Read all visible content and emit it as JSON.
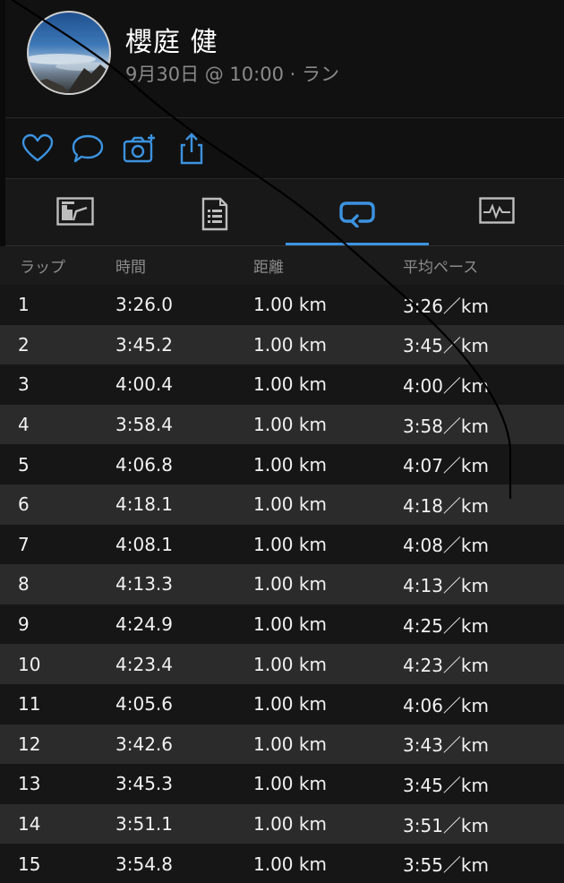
{
  "header": {
    "name": "櫻庭 健",
    "subtitle": "9月30日 @ 10:00 · ラン"
  },
  "actions": {
    "icons": [
      "heart-icon",
      "comment-icon",
      "add-photo-icon",
      "share-icon"
    ]
  },
  "tabs": {
    "items": [
      "summary-chart-icon",
      "details-document-icon",
      "laps-loop-icon",
      "graph-monitor-icon"
    ],
    "active_index": 2
  },
  "colors": {
    "accent": "#3c93e0",
    "background": "#121212",
    "row_alt": "#2b2b2b",
    "header_text": "#8c8c8c"
  },
  "laps_table": {
    "headers": {
      "lap": "ラップ",
      "time": "時間",
      "distance": "距離",
      "pace": "平均ペース"
    },
    "rows": [
      {
        "lap": "1",
        "time": "3:26.0",
        "distance": "1.00 km",
        "pace": "3:26／km"
      },
      {
        "lap": "2",
        "time": "3:45.2",
        "distance": "1.00 km",
        "pace": "3:45／km"
      },
      {
        "lap": "3",
        "time": "4:00.4",
        "distance": "1.00 km",
        "pace": "4:00／km"
      },
      {
        "lap": "4",
        "time": "3:58.4",
        "distance": "1.00 km",
        "pace": "3:58／km"
      },
      {
        "lap": "5",
        "time": "4:06.8",
        "distance": "1.00 km",
        "pace": "4:07／km"
      },
      {
        "lap": "6",
        "time": "4:18.1",
        "distance": "1.00 km",
        "pace": "4:18／km"
      },
      {
        "lap": "7",
        "time": "4:08.1",
        "distance": "1.00 km",
        "pace": "4:08／km"
      },
      {
        "lap": "8",
        "time": "4:13.3",
        "distance": "1.00 km",
        "pace": "4:13／km"
      },
      {
        "lap": "9",
        "time": "4:24.9",
        "distance": "1.00 km",
        "pace": "4:25／km"
      },
      {
        "lap": "10",
        "time": "4:23.4",
        "distance": "1.00 km",
        "pace": "4:23／km"
      },
      {
        "lap": "11",
        "time": "4:05.6",
        "distance": "1.00 km",
        "pace": "4:06／km"
      },
      {
        "lap": "12",
        "time": "3:42.6",
        "distance": "1.00 km",
        "pace": "3:43／km"
      },
      {
        "lap": "13",
        "time": "3:45.3",
        "distance": "1.00 km",
        "pace": "3:45／km"
      },
      {
        "lap": "14",
        "time": "3:51.1",
        "distance": "1.00 km",
        "pace": "3:51／km"
      },
      {
        "lap": "15",
        "time": "3:54.8",
        "distance": "1.00 km",
        "pace": "3:55／km"
      }
    ]
  }
}
